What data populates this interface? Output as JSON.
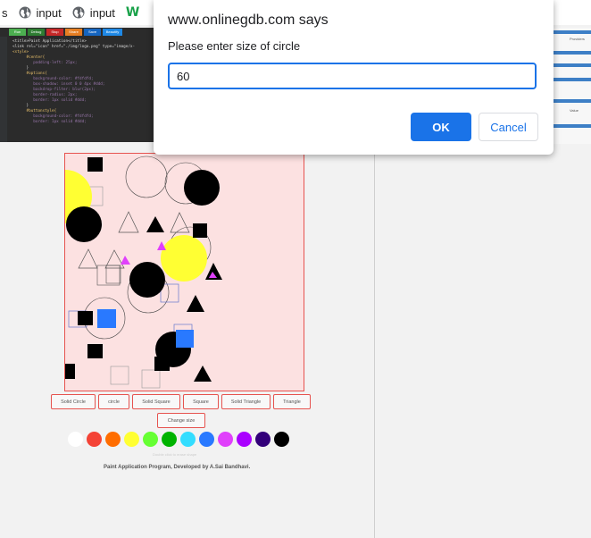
{
  "bookmarks": {
    "first_label": "s",
    "items": [
      {
        "label": "input",
        "icon": "globe-icon"
      },
      {
        "label": "input",
        "icon": "globe-icon"
      }
    ],
    "last_icon": "w3schools-icon",
    "last_label": "W"
  },
  "toolbar": {
    "buttons": [
      "Run",
      "Debug",
      "Stop",
      "Share",
      "Save",
      "Beautify"
    ],
    "colors": [
      "#4caf50",
      "#2e7d32",
      "#c62828",
      "#e67e22",
      "#1565c0",
      "#1e88e5"
    ]
  },
  "code": {
    "lines": [
      "<title>Paint Application</title>",
      "<link rel=\"icon\" href=\"./img/logo.png\" type=\"image/x-",
      "<style>",
      "",
      "      #center{",
      "         padding-left: 25px;",
      "",
      "      }",
      "      #options{",
      "         background-color: #fdfdfd;",
      "         box-shadow: inset 0 0 4px #ddd;",
      "         backdrop-filter: blur(2px);",
      "         border-radius: 2px;",
      "         border: 1px solid #ddd;",
      "      }",
      "      #buttonstyle{",
      "         background-color: #fdfdfd;",
      "         border: 1px solid #ddd;"
    ]
  },
  "right_panel": {
    "label_a": "Providers",
    "label_b": "Value"
  },
  "dialog": {
    "title": "www.onlinegdb.com says",
    "message": "Please enter size of circle",
    "input_value": "60",
    "ok_label": "OK",
    "cancel_label": "Cancel",
    "accent": "#1a73e8"
  },
  "canvas": {
    "background": "#fce1e1",
    "border": "#e6534f"
  },
  "shape_buttons": [
    "Solid Circle",
    "circle",
    "Solid Square",
    "Square",
    "Solid Triangle",
    "Triangle"
  ],
  "change_size_label": "Change size",
  "palette": [
    "#ffffff",
    "#f44336",
    "#ff6d00",
    "#ffff33",
    "#66ff33",
    "#00b300",
    "#33ddff",
    "#2979ff",
    "#e040fb",
    "#aa00ff",
    "#33007a",
    "#000000"
  ],
  "note_text": "Double click to erase shape",
  "footer_text": "Paint Application Program, Developed by A.Sai Bandhavi."
}
